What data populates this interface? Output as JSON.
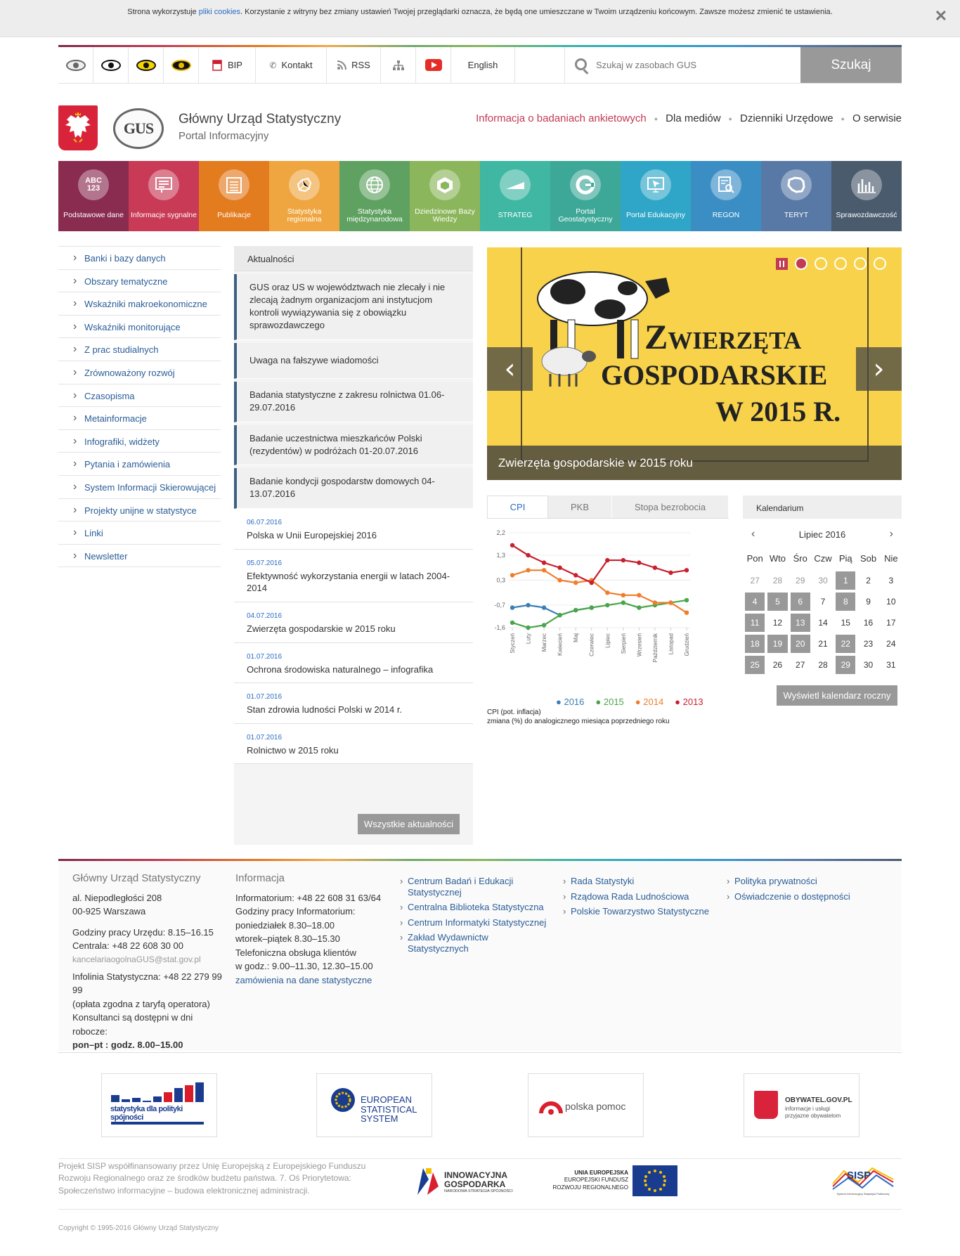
{
  "cookie": {
    "text_before": "Strona wykorzystuje ",
    "link": "pliki cookies",
    "text_after": ". Korzystanie z witryny bez zmiany ustawień Twojej przeglądarki oznacza, że będą one umieszczane w Twoim urządzeniu końcowym. Zawsze możesz zmienić te ustawienia.",
    "close": "✕"
  },
  "toolbar": {
    "bip": "BIP",
    "contact": "Kontakt",
    "rss": "RSS",
    "english": "English",
    "search_placeholder": "Szukaj w zasobach GUS",
    "search_button": "Szukaj"
  },
  "header": {
    "org_name": "Główny Urząd Statystyczny",
    "org_sub": "Portal Informacyjny",
    "gus_logo": "GUS",
    "nav": [
      "Informacja o badaniach ankietowych",
      "Dla mediów",
      "Dzienniki Urzędowe",
      "O serwisie"
    ]
  },
  "tiles": [
    {
      "label": "Podstawowe dane",
      "icon": "ABC\n123",
      "color": "#8a2c50"
    },
    {
      "label": "Informacje sygnalne",
      "icon": "doc-icon",
      "color": "#c83a55"
    },
    {
      "label": "Publikacje",
      "icon": "list-icon",
      "color": "#e37b1f"
    },
    {
      "label": "Statystyka regionalna",
      "icon": "map-icon",
      "color": "#efa640"
    },
    {
      "label": "Statystyka międzynarodowa",
      "icon": "globe-icon",
      "color": "#5fa160"
    },
    {
      "label": "Dziedzinowe Bazy Wiedzy",
      "icon": "cube-icon",
      "color": "#8bb65b"
    },
    {
      "label": "STRATEG",
      "icon": "strateg-icon",
      "color": "#3fb7a3"
    },
    {
      "label": "Portal Geostatystyczny",
      "icon": "geo-icon",
      "color": "#3da898"
    },
    {
      "label": "Portal Edukacyjny",
      "icon": "screen-icon",
      "color": "#2fa6c7"
    },
    {
      "label": "REGON",
      "icon": "regon-icon",
      "color": "#3a8ec4"
    },
    {
      "label": "TERYT",
      "icon": "poland-icon",
      "color": "#5879a6"
    },
    {
      "label": "Sprawozdawczość",
      "icon": "bars-icon",
      "color": "#4a5b6e"
    }
  ],
  "left_menu": [
    "Banki i bazy danych",
    "Obszary tematyczne",
    "Wskaźniki makroekonomiczne",
    "Wskaźniki monitorujące",
    "Z prac studialnych",
    "Zrównoważony rozwój",
    "Czasopisma",
    "Metainformacje",
    "Infografiki, widżety",
    "Pytania i zamówienia",
    "System Informacji Skierowującej",
    "Projekty unijne w statystyce",
    "Linki",
    "Newsletter"
  ],
  "news": {
    "heading": "Aktualności",
    "featured": [
      "GUS oraz US w województwach nie zlecały i nie zlecają żadnym organizacjom ani instytucjom kontroli wywiązywania się z obowiązku sprawozdawczego",
      "Uwaga na fałszywe wiadomości",
      "Badania statystyczne z zakresu rolnictwa 01.06-29.07.2016",
      "Badanie uczestnictwa mieszkańców Polski (rezydentów) w podróżach 01-20.07.2016",
      "Badanie kondycji gospodarstw domowych 04-13.07.2016"
    ],
    "items": [
      {
        "date": "06.07.2016",
        "title": "Polska w Unii Europejskiej 2016"
      },
      {
        "date": "05.07.2016",
        "title": "Efektywność wykorzystania energii w latach 2004-2014"
      },
      {
        "date": "04.07.2016",
        "title": "Zwierzęta gospodarskie w 2015 roku"
      },
      {
        "date": "01.07.2016",
        "title": "Ochrona środowiska naturalnego – infografika"
      },
      {
        "date": "01.07.2016",
        "title": "Stan zdrowia ludności Polski w 2014 r."
      },
      {
        "date": "01.07.2016",
        "title": "Rolnictwo w 2015 roku"
      }
    ],
    "all_button": "Wszystkie aktualności"
  },
  "slider": {
    "title_line1": "Zwierzęta",
    "title_line2": "gospodarskie",
    "title_line3": "w 2015 r.",
    "caption": "Zwierzęta gospodarskie w 2015 roku",
    "prev": "‹",
    "next": "›",
    "active_dot": 1,
    "dots": 6
  },
  "chart_tabs": [
    "CPI",
    "PKB",
    "Stopa bezrobocia"
  ],
  "chart_data": {
    "type": "line",
    "categories": [
      "Styczeń",
      "Luty",
      "Marzec",
      "Kwiecień",
      "Maj",
      "Czerwiec",
      "Lipiec",
      "Sierpień",
      "Wrzesień",
      "Październik",
      "Listopad",
      "Grudzień"
    ],
    "ytick_labels": [
      "2,2",
      "1,3",
      "0,3",
      "-0,7",
      "-1,6"
    ],
    "ylim": [
      -1.6,
      2.2
    ],
    "series": [
      {
        "name": "2016",
        "color": "#3a7fb5",
        "values": [
          -0.8,
          -0.7,
          -0.8,
          -1.1,
          -0.9,
          -0.8,
          null,
          null,
          null,
          null,
          null,
          null
        ]
      },
      {
        "name": "2015",
        "color": "#4aa54a",
        "values": [
          -1.4,
          -1.6,
          -1.5,
          -1.1,
          -0.9,
          -0.8,
          -0.7,
          -0.6,
          -0.8,
          -0.7,
          -0.6,
          -0.5
        ]
      },
      {
        "name": "2014",
        "color": "#ef7d2a",
        "values": [
          0.5,
          0.7,
          0.7,
          0.3,
          0.2,
          0.3,
          -0.2,
          -0.3,
          -0.3,
          -0.6,
          -0.6,
          -1.0
        ]
      },
      {
        "name": "2013",
        "color": "#c8202e",
        "values": [
          1.7,
          1.3,
          1.0,
          0.8,
          0.5,
          0.2,
          1.1,
          1.1,
          1.0,
          0.8,
          0.6,
          0.7
        ]
      }
    ],
    "note_line1": "CPI (pot. inflacja)",
    "note_line2": "zmiana (%) do analogicznego miesiąca poprzedniego roku"
  },
  "calendar": {
    "heading": "Kalendarium",
    "month": "Lipiec 2016",
    "weekdays": [
      "Pon",
      "Wto",
      "Śro",
      "Czw",
      "Pią",
      "Sob",
      "Nie"
    ],
    "days": [
      {
        "d": "27",
        "s": "prev"
      },
      {
        "d": "28",
        "s": "prev"
      },
      {
        "d": "29",
        "s": "prev"
      },
      {
        "d": "30",
        "s": "prev"
      },
      {
        "d": "1",
        "s": "mark"
      },
      {
        "d": "2",
        "s": ""
      },
      {
        "d": "3",
        "s": ""
      },
      {
        "d": "4",
        "s": "mark"
      },
      {
        "d": "5",
        "s": "mark"
      },
      {
        "d": "6",
        "s": "mark"
      },
      {
        "d": "7",
        "s": ""
      },
      {
        "d": "8",
        "s": "mark"
      },
      {
        "d": "9",
        "s": ""
      },
      {
        "d": "10",
        "s": ""
      },
      {
        "d": "11",
        "s": "mark"
      },
      {
        "d": "12",
        "s": ""
      },
      {
        "d": "13",
        "s": "mark"
      },
      {
        "d": "14",
        "s": ""
      },
      {
        "d": "15",
        "s": ""
      },
      {
        "d": "16",
        "s": ""
      },
      {
        "d": "17",
        "s": ""
      },
      {
        "d": "18",
        "s": "mark"
      },
      {
        "d": "19",
        "s": "mark"
      },
      {
        "d": "20",
        "s": "mark"
      },
      {
        "d": "21",
        "s": ""
      },
      {
        "d": "22",
        "s": "mark"
      },
      {
        "d": "23",
        "s": ""
      },
      {
        "d": "24",
        "s": ""
      },
      {
        "d": "25",
        "s": "mark"
      },
      {
        "d": "26",
        "s": ""
      },
      {
        "d": "27",
        "s": ""
      },
      {
        "d": "28",
        "s": ""
      },
      {
        "d": "29",
        "s": "mark"
      },
      {
        "d": "30",
        "s": ""
      },
      {
        "d": "31",
        "s": ""
      }
    ],
    "button": "Wyświetl kalendarz roczny"
  },
  "footer": {
    "col1_title": "Główny Urząd Statystyczny",
    "address1": "al. Niepodległości 208",
    "address2": "00-925 Warszawa",
    "hours": "Godziny pracy Urzędu: 8.15–16.15",
    "central": "Centrala: +48 22 608 30 00",
    "email": "kancelariaogolnaGUS@stat.gov.pl",
    "infoline1": "Infolinia Statystyczna: +48 22 279 99",
    "infoline2": "99",
    "infoline3": "(opłata zgodna z taryfą operatora)",
    "infoline4": "Konsultanci są dostępni w dni robocze:",
    "infoline5": "pon–pt : godz. 8.00–15.00",
    "col2_title": "Informacja",
    "info1": "Informatorium:  +48 22 608 31 63/64",
    "info2": "Godziny pracy Informatorium:",
    "info3": "poniedziałek 8.30–18.00",
    "info4": "wtorek–piątek 8.30–15.30",
    "info5": "Telefoniczna obsługa klientów",
    "info6": "w godz.: 9.00–11.30,  12.30–15.00",
    "info_link": "zamówienia na dane statystyczne",
    "links_col3": [
      "Centrum Badań i Edukacji Statystycznej",
      "Centralna Biblioteka Statystyczna",
      "Centrum Informatyki Statystycznej",
      "Zakład Wydawnictw Statystycznych"
    ],
    "links_col4": [
      "Rada Statystyki",
      "Rządowa Rada Ludnościowa",
      "Polskie Towarzystwo Statystyczne"
    ],
    "links_col5": [
      "Polityka prywatności",
      "Oświadczenie o dostępności"
    ]
  },
  "partners": {
    "p1": "statystyka dla polityki spójności",
    "p2_l1": "EUROPEAN",
    "p2_l2": "STATISTICAL",
    "p2_l3": "SYSTEM",
    "p3": "polska pomoc",
    "p4": "OBYWATEL.GOV.PL",
    "p4_sub1": "informacje i usługi",
    "p4_sub2": "przyjazne obywatelom"
  },
  "project_text": "Projekt SISP współfinansowany przez Unię Europejską z Europejskiego Funduszu Rozwoju Regionalnego oraz ze środków budżetu państwa. 7. Oś Priorytetowa: Społeczeństwo informacyjne – budowa elektronicznej administracji.",
  "eu_logos": {
    "ig1": "INNOWACYJNA",
    "ig2": "GOSPODARKA",
    "ig3": "NARODOWA STRATEGIA SPÓJNOŚCI",
    "ue1": "UNIA EUROPEJSKA",
    "ue2": "EUROPEJSKI FUNDUSZ",
    "ue3": "ROZWOJU REGIONALNEGO",
    "sisp": "SISP",
    "sisp_sub": "System Informacyjny Statystyki Publicznej"
  },
  "copyright": "Copyright © 1995-2016 Główny Urząd Statystyczny"
}
